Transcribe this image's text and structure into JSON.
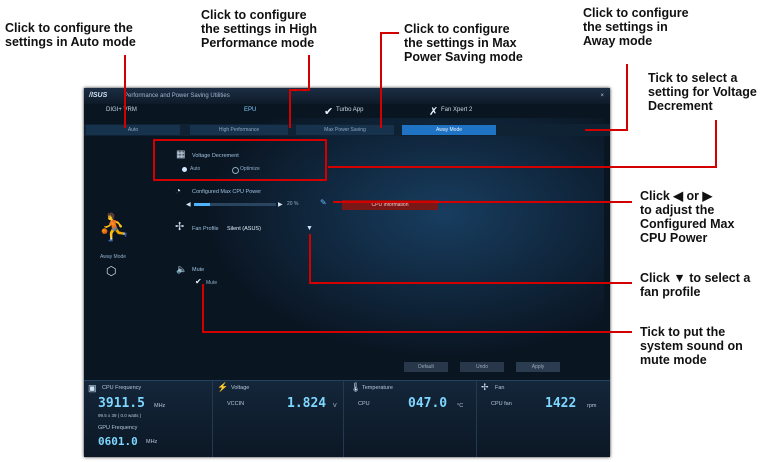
{
  "callouts": {
    "auto": "Click to configure the\nsettings in Auto mode",
    "high": "Click to configure\nthe settings in High\nPerformance mode",
    "max": "Click to configure\nthe settings in Max\nPower Saving mode",
    "away": "Click to configure\nthe settings in\nAway mode",
    "voltage": "Tick to select a\nsetting for Voltage\nDecrement",
    "power": [
      "Click ",
      " or ",
      "\nto adjust the\nConfigured Max\nCPU Power"
    ],
    "fan": [
      "Click ",
      " to select a\nfan profile"
    ],
    "mute": "Tick to put the\nsystem sound on\nmute mode"
  },
  "glyphs": {
    "left": "◀",
    "right": "▶",
    "down": "▼"
  },
  "app": {
    "title_logo": "/ISUS",
    "title": "Performance and Power Saving Utilities",
    "close": "×",
    "modules": [
      "DIGI+ VRM",
      "EPU",
      "Turbo App",
      "Fan Xpert 2"
    ],
    "tabs": [
      "Auto",
      "High Performance",
      "Max Power Saving",
      "Away Mode"
    ],
    "active_tab": 3,
    "voltage_decrement": {
      "label": "Voltage Decrement",
      "options": [
        "Auto",
        "Optimize"
      ]
    },
    "configured_power": {
      "label": "Configured Max CPU Power",
      "value": "20 %",
      "button": "CPU Information"
    },
    "fan_profile": {
      "label": "Fan Profile",
      "value": "Silent (ASUS)"
    },
    "mode_name": "Away Mode",
    "sound": {
      "label": "Mute",
      "checkbox": "Mute"
    },
    "buttons": [
      "Default",
      "Undo",
      "Apply"
    ],
    "bottom": {
      "cpu": {
        "title": "CPU Frequency",
        "value": "3911.5",
        "unit": "MHz",
        "sub": "99.5 x 39 ( 0.0 watts )",
        "gpu_title": "GPU Frequency",
        "gpu_value": "0601.0",
        "gpu_unit": "MHz"
      },
      "voltage": {
        "title": "Voltage",
        "label": "VCCIN",
        "value": "1.824",
        "unit": "V"
      },
      "temperature": {
        "title": "Temperature",
        "label": "CPU",
        "value": "047.0",
        "unit": "°C"
      },
      "fan": {
        "title": "Fan",
        "label": "CPU fan",
        "value": "1422",
        "unit": "rpm"
      }
    }
  }
}
